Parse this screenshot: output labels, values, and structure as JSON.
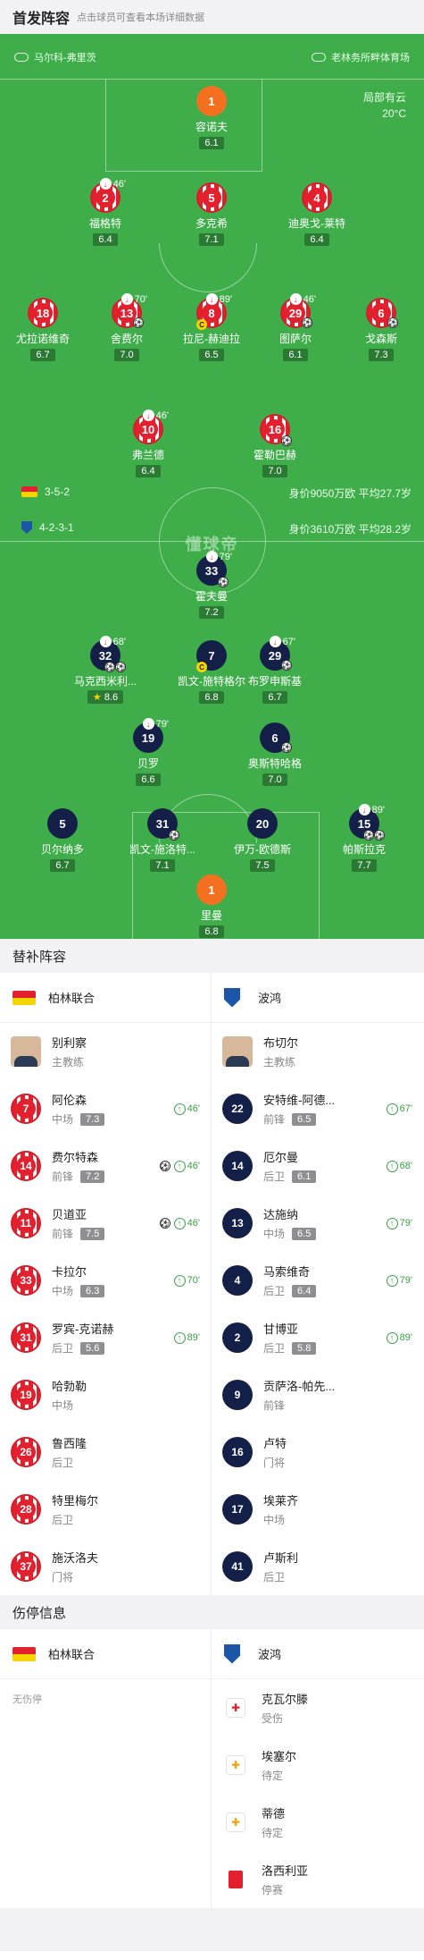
{
  "header": {
    "title": "首发阵容",
    "subtitle": "点击球员可查看本场详细数据"
  },
  "pitch": {
    "referee": "马尔科-弗里茨",
    "stadium": "老林务所畔体育场",
    "weather": "局部有云",
    "temperature": "20°C",
    "watermark": "懂球帝",
    "home": {
      "formation": "3-5-2",
      "value": "身价9050万欧",
      "avg_age": "平均27.7岁"
    },
    "away": {
      "formation": "4-2-3-1",
      "value": "身价3610万欧",
      "avg_age": "平均28.2岁"
    }
  },
  "home_players": [
    {
      "num": "1",
      "name": "容诺夫",
      "rating": "6.1"
    },
    {
      "num": "2",
      "name": "福格特",
      "rating": "6.4",
      "sub": "46'"
    },
    {
      "num": "5",
      "name": "多克希",
      "rating": "7.1"
    },
    {
      "num": "4",
      "name": "迪奥戈-莱特",
      "rating": "6.4"
    },
    {
      "num": "18",
      "name": "尤拉诺维奇",
      "rating": "6.7"
    },
    {
      "num": "13",
      "name": "舍费尔",
      "rating": "7.0",
      "sub": "70'"
    },
    {
      "num": "8",
      "name": "拉尼-赫迪拉",
      "rating": "6.5",
      "sub": "89'"
    },
    {
      "num": "29",
      "name": "图萨尔",
      "rating": "6.1",
      "sub": "46'"
    },
    {
      "num": "6",
      "name": "戈森斯",
      "rating": "7.3"
    },
    {
      "num": "10",
      "name": "弗兰德",
      "rating": "6.4",
      "sub": "46'"
    },
    {
      "num": "16",
      "name": "霍勒巴赫",
      "rating": "7.0"
    }
  ],
  "away_players": [
    {
      "num": "33",
      "name": "霍夫曼",
      "rating": "7.2",
      "sub": "79'"
    },
    {
      "num": "32",
      "name": "马克西米利...",
      "rating": "8.6",
      "sub": "68'"
    },
    {
      "num": "7",
      "name": "凯文-施特格尔",
      "rating": "6.8"
    },
    {
      "num": "29",
      "name": "布罗申斯基",
      "rating": "6.7",
      "sub": "67'"
    },
    {
      "num": "19",
      "name": "贝罗",
      "rating": "6.6",
      "sub": "79'"
    },
    {
      "num": "6",
      "name": "奥斯特哈格",
      "rating": "7.0"
    },
    {
      "num": "5",
      "name": "贝尔纳多",
      "rating": "6.7"
    },
    {
      "num": "31",
      "name": "凯文-施洛特...",
      "rating": "7.1"
    },
    {
      "num": "20",
      "name": "伊万-欧德斯",
      "rating": "7.5"
    },
    {
      "num": "15",
      "name": "帕斯拉克",
      "rating": "7.7",
      "sub": "89'"
    },
    {
      "num": "1",
      "name": "里曼",
      "rating": "6.8"
    }
  ],
  "subs_section": {
    "title": "替补阵容"
  },
  "teams": {
    "home": "柏林联合",
    "away": "波鸿"
  },
  "home_subs": [
    {
      "num": "",
      "name": "别利察",
      "pos": "主教练",
      "rating": "",
      "time": ""
    },
    {
      "num": "7",
      "name": "阿伦森",
      "pos": "中场",
      "rating": "7.3",
      "time": "46'"
    },
    {
      "num": "14",
      "name": "费尔特森",
      "pos": "前锋",
      "rating": "7.2",
      "time": "46'"
    },
    {
      "num": "11",
      "name": "贝道亚",
      "pos": "前锋",
      "rating": "7.5",
      "time": "46'"
    },
    {
      "num": "33",
      "name": "卡拉尔",
      "pos": "中场",
      "rating": "6.3",
      "time": "70'"
    },
    {
      "num": "31",
      "name": "罗宾-克诺赫",
      "pos": "后卫",
      "rating": "5.6",
      "time": "89'"
    },
    {
      "num": "19",
      "name": "哈勃勒",
      "pos": "中场",
      "rating": "",
      "time": ""
    },
    {
      "num": "26",
      "name": "鲁西隆",
      "pos": "后卫",
      "rating": "",
      "time": ""
    },
    {
      "num": "28",
      "name": "特里梅尔",
      "pos": "后卫",
      "rating": "",
      "time": ""
    },
    {
      "num": "37",
      "name": "施沃洛夫",
      "pos": "门将",
      "rating": "",
      "time": ""
    }
  ],
  "away_subs": [
    {
      "num": "",
      "name": "布切尔",
      "pos": "主教练",
      "rating": "",
      "time": ""
    },
    {
      "num": "22",
      "name": "安特维-阿德...",
      "pos": "前锋",
      "rating": "6.5",
      "time": "67'"
    },
    {
      "num": "14",
      "name": "厄尔曼",
      "pos": "后卫",
      "rating": "6.1",
      "time": "68'"
    },
    {
      "num": "13",
      "name": "达施纳",
      "pos": "中场",
      "rating": "6.5",
      "time": "79'"
    },
    {
      "num": "4",
      "name": "马索维奇",
      "pos": "后卫",
      "rating": "6.4",
      "time": "79'"
    },
    {
      "num": "2",
      "name": "甘博亚",
      "pos": "后卫",
      "rating": "5.8",
      "time": "89'"
    },
    {
      "num": "9",
      "name": "贡萨洛-帕先...",
      "pos": "前锋",
      "rating": "",
      "time": ""
    },
    {
      "num": "16",
      "name": "卢特",
      "pos": "门将",
      "rating": "",
      "time": ""
    },
    {
      "num": "17",
      "name": "埃莱齐",
      "pos": "中场",
      "rating": "",
      "time": ""
    },
    {
      "num": "41",
      "name": "卢斯利",
      "pos": "后卫",
      "rating": "",
      "time": ""
    }
  ],
  "injury_section": {
    "title": "伤停信息"
  },
  "injuries": {
    "home_none": "无伤停",
    "away": [
      {
        "name": "克瓦尔滕",
        "status": "受伤"
      },
      {
        "name": "埃塞尔",
        "status": "待定"
      },
      {
        "name": "蒂德",
        "status": "待定"
      },
      {
        "name": "洛西利亚",
        "status": "停赛"
      }
    ]
  },
  "colors": {
    "pitch": "#3fae4a",
    "home": "#e2202e",
    "away": "#142048",
    "keeper": "#f37021"
  }
}
